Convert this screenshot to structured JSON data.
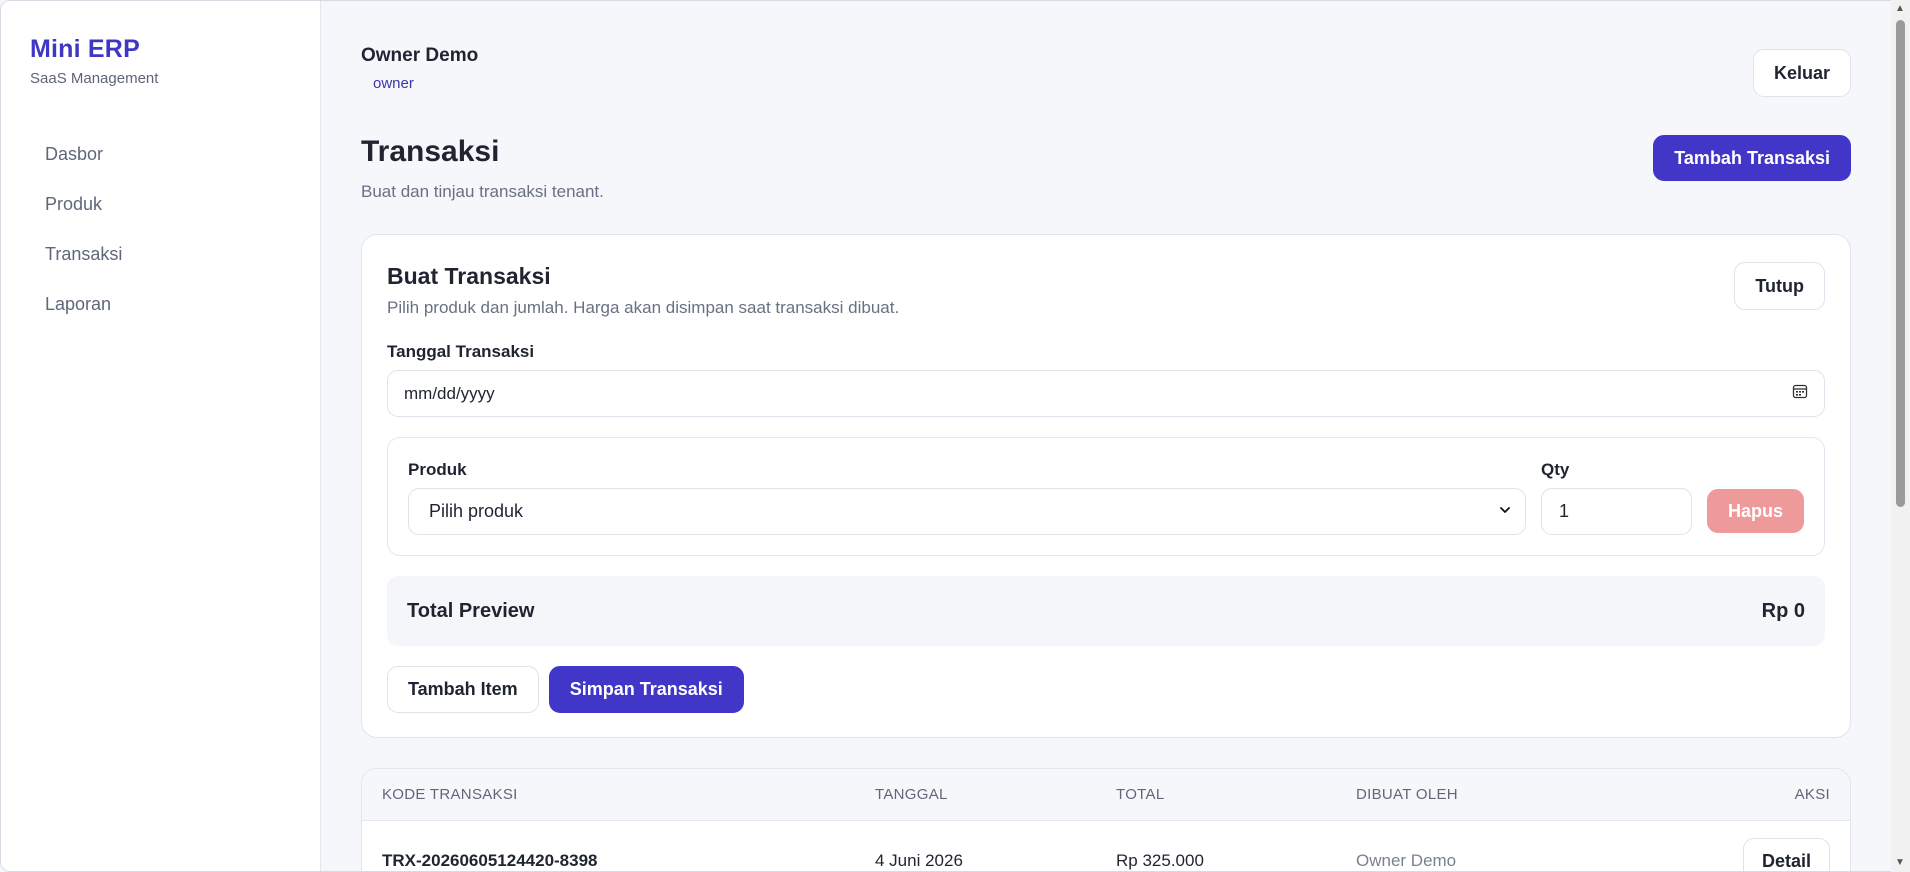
{
  "sidebar": {
    "brand": "Mini ERP",
    "brand_sub": "SaaS Management",
    "items": [
      {
        "label": "Dasbor"
      },
      {
        "label": "Produk"
      },
      {
        "label": "Transaksi"
      },
      {
        "label": "Laporan"
      }
    ]
  },
  "topbar": {
    "user_name": "Owner Demo",
    "role": "owner",
    "logout_label": "Keluar"
  },
  "page": {
    "title": "Transaksi",
    "subtitle": "Buat dan tinjau transaksi tenant.",
    "add_button": "Tambah Transaksi"
  },
  "form": {
    "title": "Buat Transaksi",
    "subtitle": "Pilih produk dan jumlah. Harga akan disimpan saat transaksi dibuat.",
    "close_label": "Tutup",
    "date_label": "Tanggal Transaksi",
    "date_placeholder": "mm/dd/yyyy",
    "product_label": "Produk",
    "product_selected": "Pilih produk",
    "qty_label": "Qty",
    "qty_value": "1",
    "delete_label": "Hapus",
    "total_label": "Total Preview",
    "total_value": "Rp 0",
    "add_item_label": "Tambah Item",
    "save_label": "Simpan Transaksi"
  },
  "table": {
    "headers": [
      "KODE TRANSAKSI",
      "TANGGAL",
      "TOTAL",
      "DIBUAT OLEH",
      "AKSI"
    ],
    "rows": [
      {
        "code": "TRX-20260605124420-8398",
        "date": "4 Juni 2026",
        "total": "Rp 325.000",
        "created_by": "Owner Demo",
        "action": "Detail"
      }
    ]
  },
  "colors": {
    "brand": "#3f36c6",
    "primary": "#4236c8",
    "danger_disabled": "#ef9a9a",
    "background": "#f6f7fb"
  }
}
